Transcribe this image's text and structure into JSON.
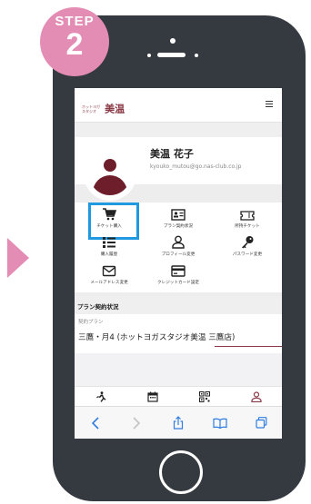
{
  "step": {
    "word": "STEP",
    "number": "2"
  },
  "brand": {
    "logo_small": "ホットヨガ スタジオ",
    "logo_big": "美温"
  },
  "profile": {
    "name": "美温 花子",
    "email": "kyouko_mutou@go.nas-club.co.jp"
  },
  "menu": [
    {
      "label": "チケット購入",
      "icon": "cart-icon",
      "selected": true
    },
    {
      "label": "プラン契約状況",
      "icon": "id-card-icon",
      "selected": false
    },
    {
      "label": "所持チケット",
      "icon": "ticket-icon",
      "selected": false
    },
    {
      "label": "購入履歴",
      "icon": "list-icon",
      "selected": false
    },
    {
      "label": "プロフィール変更",
      "icon": "person-icon",
      "selected": false
    },
    {
      "label": "パスワード変更",
      "icon": "key-icon",
      "selected": false
    },
    {
      "label": "メールアドレス変更",
      "icon": "mail-icon",
      "selected": false
    },
    {
      "label": "クレジットカード設定",
      "icon": "credit-card-icon",
      "selected": false
    }
  ],
  "plan_section": {
    "title": "プラン契約状況",
    "label": "契約プラン",
    "value": "三鷹・月4 (ホットヨガスタジオ美温 三鷹店)"
  },
  "colors": {
    "accent_pink": "#e48db4",
    "brand": "#6e1e2a",
    "highlight": "#1f9ae0",
    "phone": "#343a40"
  }
}
